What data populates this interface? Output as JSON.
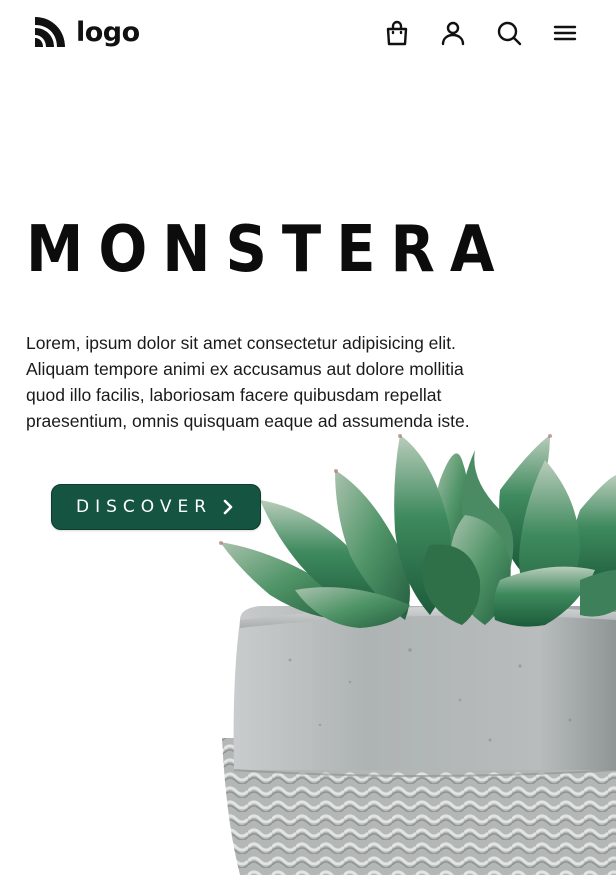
{
  "header": {
    "logo_text": "logo",
    "icons": [
      "shopping-bag-icon",
      "user-icon",
      "search-icon",
      "menu-icon"
    ]
  },
  "hero": {
    "title": "MONSTERA",
    "description": "Lorem, ipsum dolor sit amet consectetur adipisicing elit. Aliquam tempore animi ex accusamus aut dolore mollitia quod illo facilis, laboriosam facere quibusdam repellat praesentium, omnis quisquam eaque ad assumenda iste.",
    "button_label": "DISCOVER"
  },
  "colors": {
    "accent": "#145440",
    "text": "#111111",
    "background": "#ffffff"
  }
}
